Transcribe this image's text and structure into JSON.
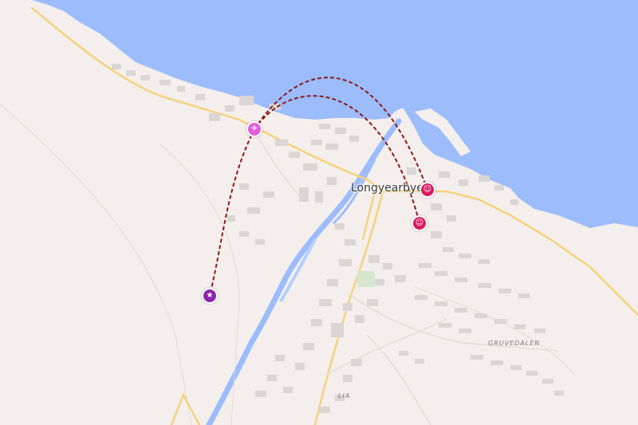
{
  "map": {
    "town_label": "Longyearbyen",
    "districts": [
      {
        "name": "GRUVEDALEN"
      },
      {
        "name": "LIA"
      }
    ],
    "colors": {
      "land": "#f4efec",
      "water": "#9cbcfc",
      "road": "#f5d27e",
      "building": "#d9d5d2",
      "route": "#8b1a1a"
    },
    "markers": [
      {
        "name": "airport-marker",
        "icon": "airplane-icon",
        "color": "#e05fd6",
        "glyph": "✈"
      },
      {
        "name": "theatre-marker-1",
        "icon": "theatre-masks-icon",
        "color": "#d81b60",
        "glyph": "☺"
      },
      {
        "name": "theatre-marker-2",
        "icon": "theatre-masks-icon",
        "color": "#d81b60",
        "glyph": "☺"
      },
      {
        "name": "start-marker",
        "icon": "star-icon",
        "color": "#8e24aa",
        "glyph": "★"
      }
    ]
  }
}
